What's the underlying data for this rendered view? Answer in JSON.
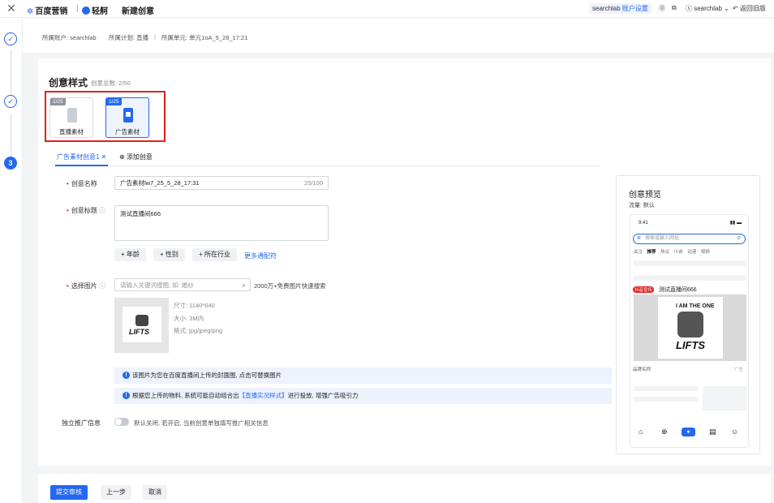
{
  "header": {
    "close": "✕",
    "brand": "百度营销",
    "product": "轻舸",
    "title": "新建创意",
    "account_user": "searchlab",
    "account_settings": "账户设置",
    "user": "searchlab",
    "back": "返回旧版"
  },
  "steps": [
    "✓",
    "✓",
    "3"
  ],
  "breadcrumb": {
    "account": "所属账户: searchlab",
    "plan": "所属计划: 直播",
    "unit": "所属单元: 单元1oA_5_28_17:21"
  },
  "section": {
    "title": "创意样式",
    "count": "创意总数: 2/50"
  },
  "tiles": [
    {
      "badge": "1/25",
      "label": "直播素材"
    },
    {
      "badge": "1/25",
      "label": "广告素材"
    }
  ],
  "tabs": {
    "active": "广告素材创意1 ✕",
    "add": "⊕ 添加创意"
  },
  "form": {
    "name_label": "创意名称",
    "name_value": "广告素材lw7_25_5_28_17:31",
    "name_count": "25/100",
    "title_label": "创意标题",
    "title_value": "测试直播间666",
    "wildcards": [
      "+ 年龄",
      "+ 性别",
      "+ 所在行业"
    ],
    "more_wildcards": "更多通配符",
    "image_label": "选择图片",
    "image_placeholder": "请输入关键词搜图, 如: 婚纱",
    "image_search_hint": "2000万+免费图片快速搜索",
    "image_size": "尺寸: 1140*640",
    "image_filesize": "大小: 3M内",
    "image_format": "格式: jpg/jpeg/png",
    "note1": "该图片为您在百度直播间上传的封面图, 点击可替换图片",
    "note2_pre": "根据您上传的物料, 系统可能自动组合出",
    "note2_link": "【直播实况样式】",
    "note2_post": "进行投放, 增强广告吸引力",
    "promo_label": "独立推广信息",
    "promo_hint": "默认关闭, 若开启, 当前创意单独填写推广相关信息"
  },
  "preview": {
    "title": "创意预览",
    "traffic": "流量: 默认",
    "time": "9:41",
    "search_placeholder": "搜索或输入网址",
    "nav": [
      "关注",
      "推荐",
      "热议",
      "小说",
      "动漫",
      "视频"
    ],
    "ad_tag": "抖音宣传",
    "ad_title": "测试直播间666",
    "brand_name": "品牌名称",
    "ad_label": "广告",
    "shirt_text1": "I AM THE ONE",
    "shirt_text2": "LIFTS"
  },
  "footer": {
    "submit": "提交审核",
    "prev": "上一步",
    "cancel": "取消"
  },
  "colors": {
    "primary": "#2468f2",
    "danger": "#e02020"
  }
}
